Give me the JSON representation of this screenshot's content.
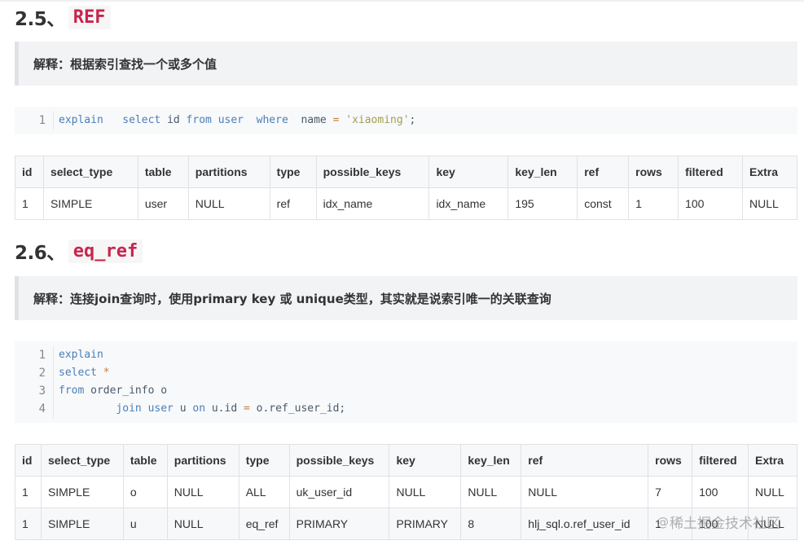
{
  "section1": {
    "number": "2.5、",
    "title": "REF",
    "explain": "解释：根据索引查找一个或多个值",
    "code_lines": [
      {
        "n": "1",
        "parts": [
          {
            "t": "explain   select ",
            "c": "kw"
          },
          {
            "t": "id ",
            "c": ""
          },
          {
            "t": "from ",
            "c": "kw"
          },
          {
            "t": "user  ",
            "c": "kw"
          },
          {
            "t": "where  ",
            "c": "kw"
          },
          {
            "t": "name ",
            "c": ""
          },
          {
            "t": "= ",
            "c": "op"
          },
          {
            "t": "'xiaoming'",
            "c": "str"
          },
          {
            "t": ";",
            "c": ""
          }
        ]
      }
    ],
    "table": {
      "headers": [
        "id",
        "select_type",
        "table",
        "partitions",
        "type",
        "possible_keys",
        "key",
        "key_len",
        "ref",
        "rows",
        "filtered",
        "Extra"
      ],
      "rows": [
        [
          "1",
          "SIMPLE",
          "user",
          "NULL",
          "ref",
          "idx_name",
          "idx_name",
          "195",
          "const",
          "1",
          "100",
          "NULL"
        ]
      ]
    }
  },
  "section2": {
    "number": "2.6、",
    "title": "eq_ref",
    "explain": "解释：连接join查询时，使用primary key 或 unique类型，其实就是说索引唯一的关联查询",
    "code_lines": [
      {
        "n": "1",
        "parts": [
          {
            "t": "explain",
            "c": "kw"
          }
        ]
      },
      {
        "n": "2",
        "parts": [
          {
            "t": "select ",
            "c": "kw"
          },
          {
            "t": "*",
            "c": "op"
          }
        ]
      },
      {
        "n": "3",
        "parts": [
          {
            "t": "from ",
            "c": "kw"
          },
          {
            "t": "order_info o",
            "c": ""
          }
        ]
      },
      {
        "n": "4",
        "parts": [
          {
            "t": "         join ",
            "c": "kw"
          },
          {
            "t": "user ",
            "c": "kw"
          },
          {
            "t": "u ",
            "c": ""
          },
          {
            "t": "on ",
            "c": "kw"
          },
          {
            "t": "u.id ",
            "c": ""
          },
          {
            "t": "= ",
            "c": "op"
          },
          {
            "t": "o.ref_user_id;",
            "c": ""
          }
        ]
      }
    ],
    "table": {
      "headers": [
        "id",
        "select_type",
        "table",
        "partitions",
        "type",
        "possible_keys",
        "key",
        "key_len",
        "ref",
        "rows",
        "filtered",
        "Extra"
      ],
      "rows": [
        [
          "1",
          "SIMPLE",
          "o",
          "NULL",
          "ALL",
          "uk_user_id",
          "NULL",
          "NULL",
          "NULL",
          "7",
          "100",
          "NULL"
        ],
        [
          "1",
          "SIMPLE",
          "u",
          "NULL",
          "eq_ref",
          "PRIMARY",
          "PRIMARY",
          "8",
          "hlj_sql.o.ref_user_id",
          "1",
          "100",
          "NULL"
        ]
      ]
    }
  },
  "watermark": {
    "at": "@",
    "text": "稀土掘金技术社区"
  }
}
